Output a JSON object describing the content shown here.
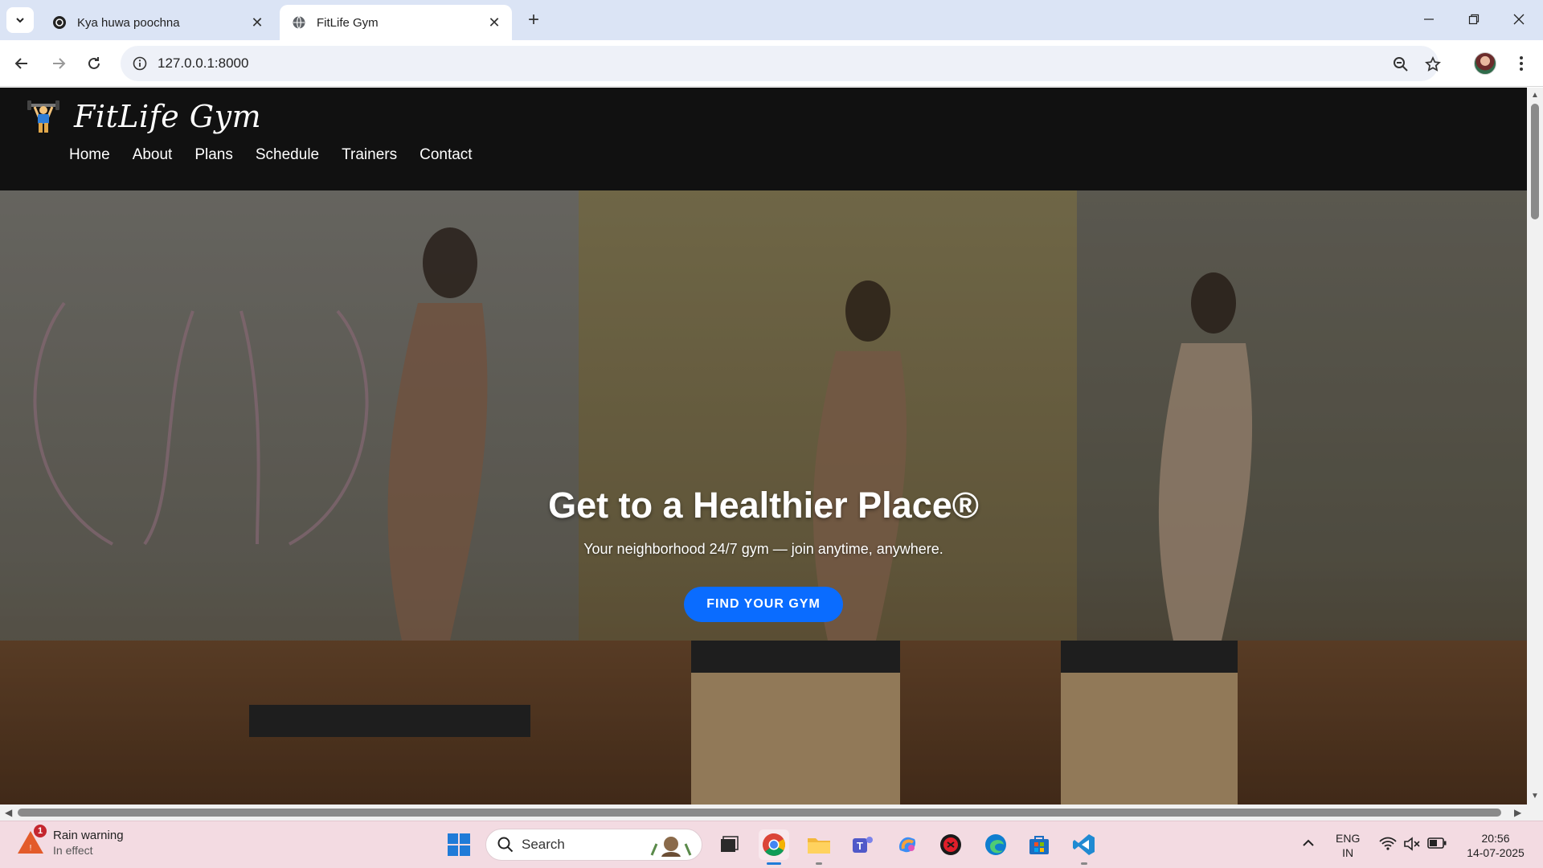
{
  "browser": {
    "tabs": [
      {
        "title": "Kya huwa poochna",
        "active": false
      },
      {
        "title": "FitLife Gym",
        "active": true
      }
    ],
    "url": "127.0.0.1:8000"
  },
  "site": {
    "brand": "FitLife Gym",
    "nav": [
      "Home",
      "About",
      "Plans",
      "Schedule",
      "Trainers",
      "Contact"
    ],
    "hero": {
      "title": "Get to a Healthier Place®",
      "subtitle": "Your neighborhood 24/7 gym — join anytime, anywhere.",
      "cta": "FIND YOUR GYM"
    },
    "accent_color": "#0a6cff"
  },
  "taskbar": {
    "weather": {
      "title": "Rain warning",
      "status": "In effect",
      "badge": "1"
    },
    "search_placeholder": "Search",
    "language": {
      "line1": "ENG",
      "line2": "IN"
    },
    "clock": {
      "time": "20:56",
      "date": "14-07-2025"
    }
  }
}
